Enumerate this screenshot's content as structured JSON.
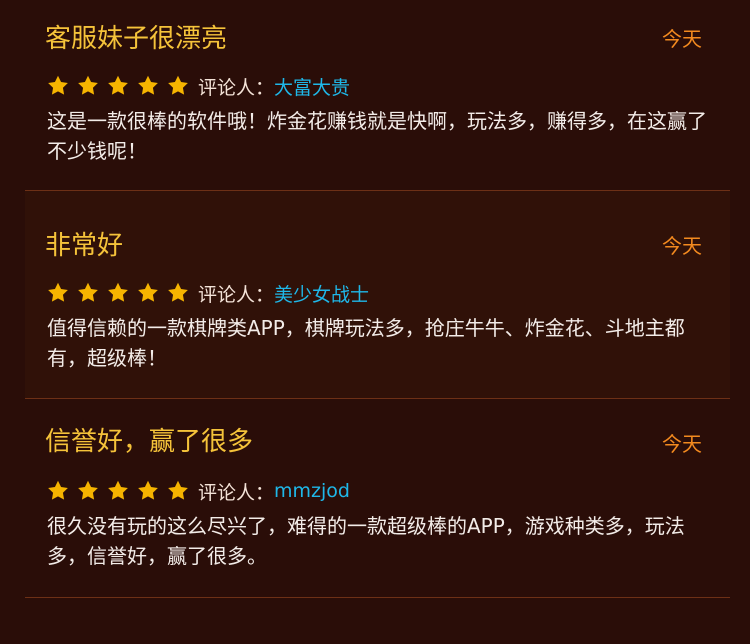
{
  "rating_label": "评论人：",
  "colors": {
    "background": "#2a0d08",
    "card_alt_background": "#301108",
    "title": "#f5c33a",
    "date": "#f38a1f",
    "reviewer": "#1fb7e8",
    "body_text": "#f3ece8",
    "star": "#f6b400",
    "divider": "#6d3016"
  },
  "reviews": [
    {
      "title": "客服妹子很漂亮",
      "date": "今天",
      "rating": 5,
      "reviewer": "大富大贵",
      "body": "这是一款很棒的软件哦！炸金花赚钱就是快啊，玩法多，赚得多，在这赢了不少钱呢！",
      "star_icon": "star-icon"
    },
    {
      "title": "非常好",
      "date": "今天",
      "rating": 5,
      "reviewer": "美少女战士",
      "body": "值得信赖的一款棋牌类APP，棋牌玩法多，抢庄牛牛、炸金花、斗地主都有，超级棒！",
      "star_icon": "star-icon"
    },
    {
      "title": "信誉好，赢了很多",
      "date": "今天",
      "rating": 5,
      "reviewer": "mmzjod",
      "body": "很久没有玩的这么尽兴了，难得的一款超级棒的APP，游戏种类多，玩法多，信誉好，赢了很多。",
      "star_icon": "star-icon"
    }
  ]
}
